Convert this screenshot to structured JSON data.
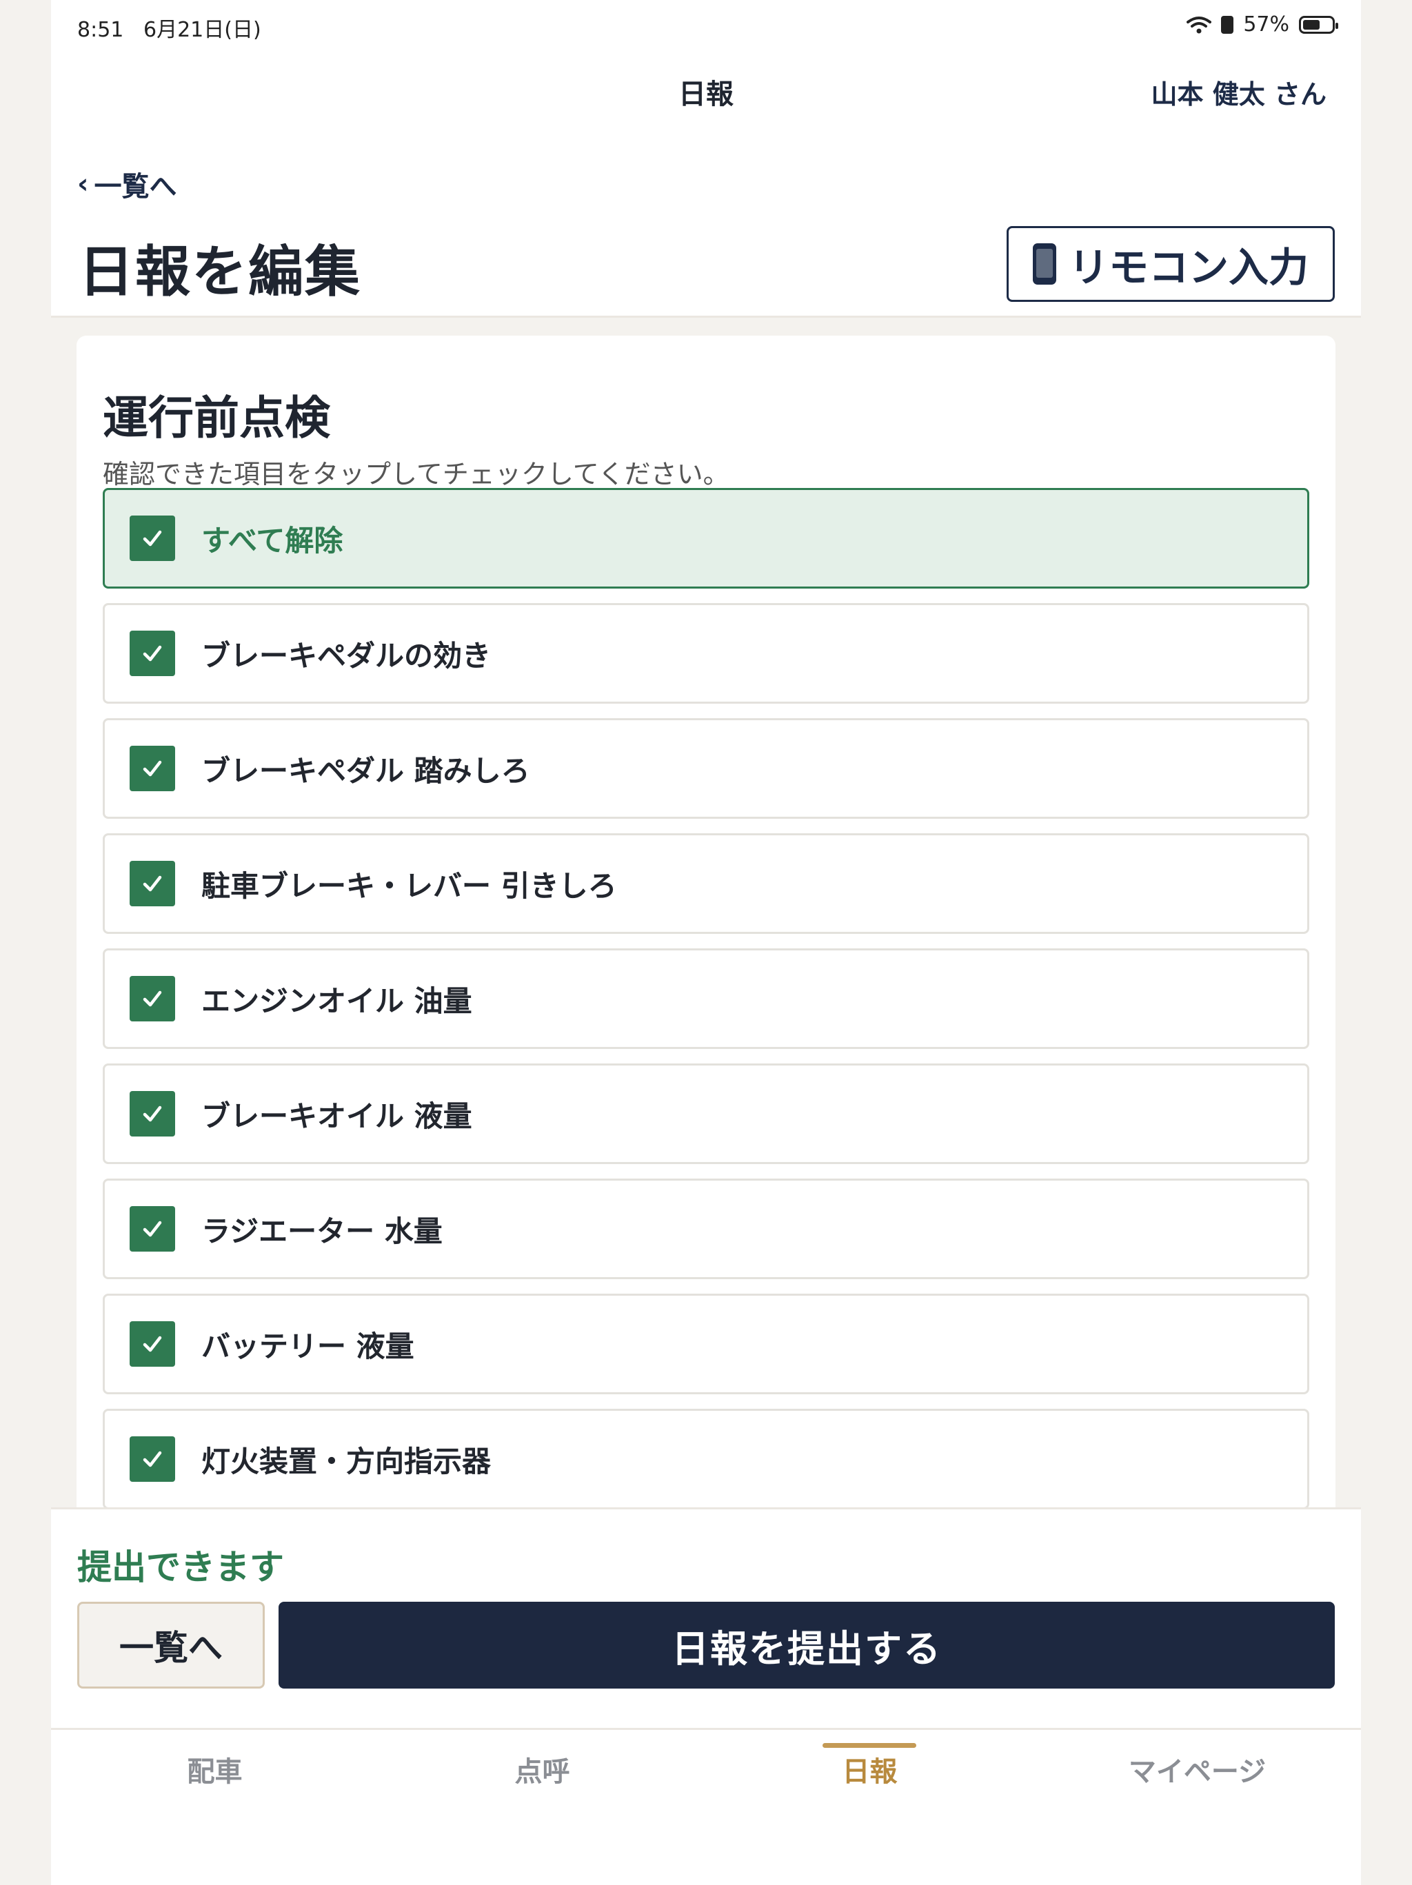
{
  "status_bar": {
    "time": "8:51",
    "date": "6月21日(日)",
    "battery": "57%"
  },
  "header": {
    "title": "日報",
    "user": "山本 健太 さん"
  },
  "back_link": {
    "chevron": "‹",
    "label": "一覧へ"
  },
  "page_title": "日報を編集",
  "remote_button": {
    "label": "リモコン入力",
    "icon": "mobile-phone-icon"
  },
  "section": {
    "title": "運行前点検",
    "hint": "確認できた項目をタップしてチェックしてください。",
    "toggle_all": {
      "label": "すべて解除",
      "checked": true
    },
    "items": [
      {
        "label": "ブレーキペダルの効き",
        "checked": true
      },
      {
        "label": "ブレーキペダル 踏みしろ",
        "checked": true
      },
      {
        "label": "駐車ブレーキ・レバー 引きしろ",
        "checked": true
      },
      {
        "label": "エンジンオイル 油量",
        "checked": true
      },
      {
        "label": "ブレーキオイル 液量",
        "checked": true
      },
      {
        "label": "ラジエーター 水量",
        "checked": true
      },
      {
        "label": "バッテリー 液量",
        "checked": true
      },
      {
        "label": "灯火装置・方向指示器",
        "checked": true
      }
    ]
  },
  "submit": {
    "status": "提出できます",
    "list_button": "一覧へ",
    "submit_button": "日報を提出する"
  },
  "tabs": [
    {
      "label": "配車",
      "active": false
    },
    {
      "label": "点呼",
      "active": false
    },
    {
      "label": "日報",
      "active": true
    },
    {
      "label": "マイページ",
      "active": false
    }
  ],
  "colors": {
    "accent_green": "#2f7d52",
    "navy": "#1d2840",
    "tab_active": "#b88a3e"
  }
}
